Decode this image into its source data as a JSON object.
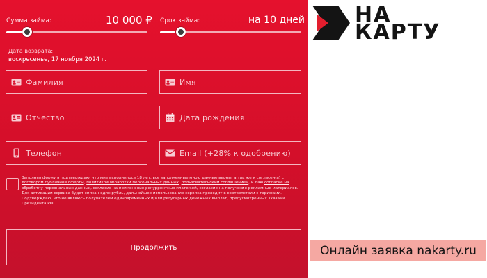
{
  "form": {
    "amount_label": "Сумма займа:",
    "amount_value": "10 000 ₽",
    "amount_fraction": 0.15,
    "term_label": "Срок займа:",
    "term_value": "на 10 дней",
    "term_fraction": 0.15,
    "return_date_label": "Дата возврата:",
    "return_date_value": "воскресенье, 17 ноября 2024 г.",
    "placeholders": {
      "last_name": "Фамилия",
      "first_name": "Имя",
      "middle_name": "Отчество",
      "birth_date": "Дата рождения",
      "phone": "Телефон",
      "email": "Email (+28% к одобрению)"
    },
    "consent": {
      "p1": "Заполняя форму я подтверждаю, что мне исполнилось 18 лет, все заполненные мною данные верны, а так же я согласен(а) с ",
      "l1": "договором публичной оферты",
      "p2": ", ",
      "l2": "политикой обработки персональных данных",
      "p3": ", ",
      "l3": "пользовательским соглашением",
      "p4": ", и даю ",
      "l4": "согласие на обработку персональных данных",
      "p5": ", ",
      "l5": "согласие на применение рекуррентных платежей",
      "p6": ", ",
      "l6": "согласие на получение рекламных материалов",
      "p7": ". Для активации сервиса будет списан один рубль, дальнейшее использование сервиса проходит в соответствии с ",
      "l7": "тарифами",
      "p8": ". Подтверждаю, что не являюсь получателем единовременных и/или регулярных денежных выплат, предусмотренных Указами Президента РФ."
    },
    "submit_label": "Продолжить"
  },
  "logo": {
    "text_top": "НА",
    "text_bottom": "КАРТУ"
  },
  "caption": "Онлайн заявка nakarty.ru",
  "colors": {
    "panel": "#e5112d",
    "caption_bg": "#f5a8a2",
    "logo_red": "#e31e2e"
  },
  "icons": {
    "last_name": "id-card-icon",
    "first_name": "id-card-icon",
    "middle_name": "id-card-icon",
    "birth_date": "calendar-icon",
    "phone": "phone-icon",
    "email": "envelope-icon"
  }
}
